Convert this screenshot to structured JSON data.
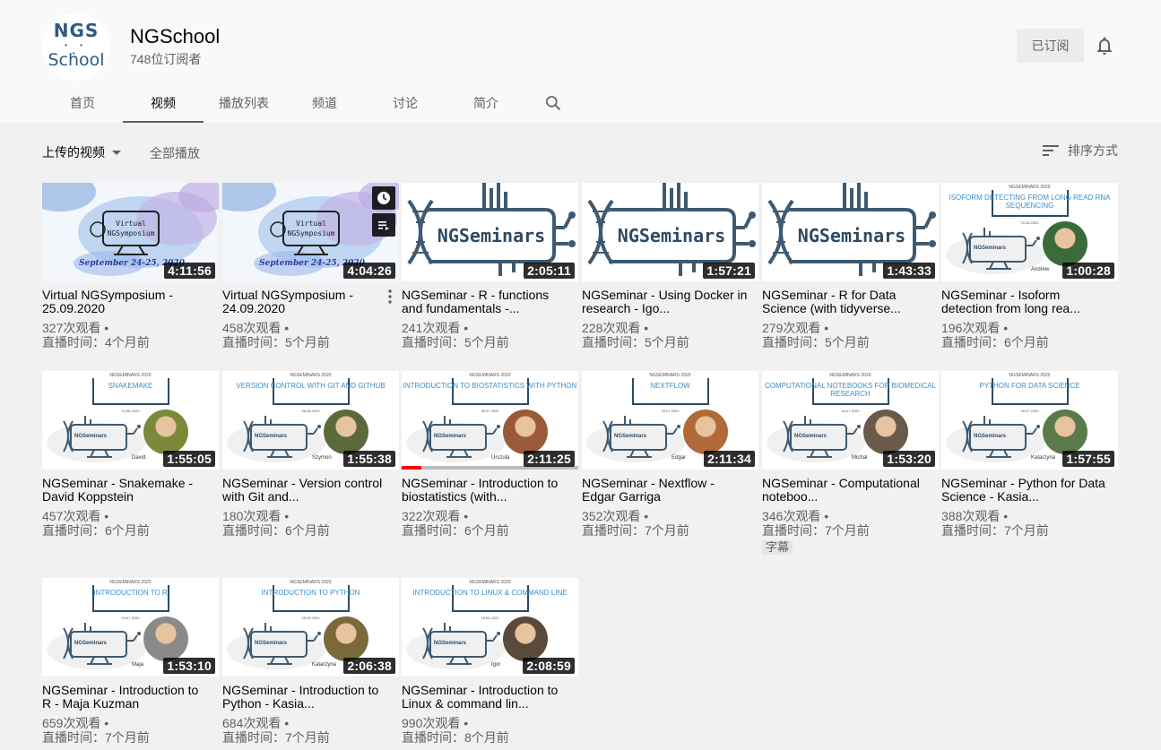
{
  "channel": {
    "avatar_text_top": "NGS",
    "avatar_text_bottom": "School",
    "name": "NGSchool",
    "subscribers": "748位订阅者",
    "subscribed_label": "已订阅"
  },
  "tabs": [
    {
      "label": "首页"
    },
    {
      "label": "视频"
    },
    {
      "label": "播放列表"
    },
    {
      "label": "频道"
    },
    {
      "label": "讨论"
    },
    {
      "label": "简介"
    }
  ],
  "toolbar": {
    "uploads_label": "上传的视频",
    "play_all_label": "全部播放",
    "sort_label": "排序方式"
  },
  "colors": {
    "accent_red": "#ff0000",
    "brand_blue": "#2e5a84",
    "text_secondary": "#606060"
  },
  "videos": [
    {
      "title": "Virtual NGSymposium - 25.09.2020",
      "duration": "4:11:56",
      "views": "327次观看 •",
      "time": "直播时间：4个月前",
      "thumb": "symposium"
    },
    {
      "title": "Virtual NGSymposium - 24.09.2020",
      "duration": "4:04:26",
      "views": "458次观看 •",
      "time": "直播时间：5个月前",
      "thumb": "symposium",
      "hover": true
    },
    {
      "title": "NGSeminar - R - functions and fundamentals -...",
      "duration": "2:05:11",
      "views": "241次观看 •",
      "time": "直播时间：5个月前",
      "thumb": "seminars",
      "logo_text": "NGSeminars"
    },
    {
      "title": "NGSeminar - Using Docker in research - Igo...",
      "duration": "1:57:21",
      "views": "228次观看 •",
      "time": "直播时间：5个月前",
      "thumb": "seminars",
      "logo_text": "NGSeminars"
    },
    {
      "title": "NGSeminar - R for Data Science (with tidyverse...",
      "duration": "1:43:33",
      "views": "279次观看 •",
      "time": "直播时间：5个月前",
      "thumb": "seminars",
      "logo_text": "NGSeminars"
    },
    {
      "title": "NGSeminar - Isoform detection from long rea...",
      "duration": "1:00:28",
      "views": "196次观看 •",
      "time": "直播时间：6个月前",
      "thumb": "slide",
      "slide_header": "NGSEMINARS 2020",
      "slide_title": "ISOFORM DETECTING FROM LONG READ RNA SEQUENCING",
      "slide_date": "20.08.2020",
      "person": "Andrew",
      "face_color": "#3a6b3a"
    },
    {
      "title": "NGSeminar - Snakemake - David Koppstein",
      "duration": "1:55:05",
      "views": "457次观看 •",
      "time": "直播时间：6个月前",
      "thumb": "slide",
      "slide_header": "NGSEMINARS 2020",
      "slide_title": "SNAKEMAKE",
      "slide_date": "13.08.2020",
      "person": "David",
      "face_color": "#7a8a3a"
    },
    {
      "title": "NGSeminar - Version control with Git and...",
      "duration": "1:55:38",
      "views": "180次观看 •",
      "time": "直播时间：6个月前",
      "thumb": "slide",
      "slide_header": "NGSEMINARS 2020",
      "slide_title": "VERSION CONTROL WITH GIT AND GITHUB",
      "slide_date": "06.08.2020",
      "person": "Szymon",
      "face_color": "#5a6a3a"
    },
    {
      "title": "NGSeminar - Introduction to biostatistics (with...",
      "duration": "2:11:25",
      "views": "322次观看 •",
      "time": "直播时间：6个月前",
      "thumb": "slide",
      "slide_header": "NGSEMINARS 2020",
      "slide_title": "INTRODUCTION TO BIOSTATISTICS WITH PYTHON",
      "slide_date": "30.07.2020",
      "person": "Urszula",
      "face_color": "#9a5a3a",
      "progress": 0.11
    },
    {
      "title": "NGSeminar - Nextflow - Edgar Garriga",
      "duration": "2:11:34",
      "views": "352次观看 •",
      "time": "直播时间：7个月前",
      "thumb": "slide",
      "slide_header": "NGSEMINARS 2020",
      "slide_title": "NEXTFLOW",
      "slide_date": "23.07.2020",
      "person": "Edgar",
      "face_color": "#b06a3a"
    },
    {
      "title": "NGSeminar - Computational noteboo...",
      "duration": "1:53:20",
      "views": "346次观看 •",
      "time": "直播时间：7个月前",
      "thumb": "slide",
      "slide_header": "NGSEMINARS 2020",
      "slide_title": "COMPUTATIONAL NOTEBOOKS FOR BIOMEDICAL RESEARCH",
      "slide_date": "16.07.2020",
      "person": "Michal",
      "face_color": "#6a5a4a",
      "badge": "字幕"
    },
    {
      "title": "NGSeminar - Python for Data Science - Kasia...",
      "duration": "1:57:55",
      "views": "388次观看 •",
      "time": "直播时间：7个月前",
      "thumb": "slide",
      "slide_header": "NGSEMINARS 2020",
      "slide_title": "PYTHON FOR DATA SCIENCE",
      "slide_date": "09.07.2020",
      "person": "Katarzyna",
      "face_color": "#5a7a4a"
    },
    {
      "title": "NGSeminar - Introduction to R - Maja Kuzman",
      "duration": "1:53:10",
      "views": "659次观看 •",
      "time": "直播时间：7个月前",
      "thumb": "slide",
      "slide_header": "NGSEMINARS 2020",
      "slide_title": "INTRODUCTION TO R",
      "slide_date": "02.07.2020",
      "person": "Maja",
      "face_color": "#8a8a8a"
    },
    {
      "title": "NGSeminar - Introduction to Python - Kasia...",
      "duration": "2:06:38",
      "views": "684次观看 •",
      "time": "直播时间：7个月前",
      "thumb": "slide",
      "slide_header": "NGSEMINARS 2020",
      "slide_title": "INTRODUCTION TO PYTHON",
      "slide_date": "25.06.2020",
      "person": "Katarzyna",
      "face_color": "#7a6a3a"
    },
    {
      "title": "NGSeminar - Introduction to Linux & command lin...",
      "duration": "2:08:59",
      "views": "990次观看 •",
      "time": "直播时间：8个月前",
      "thumb": "slide",
      "slide_header": "NGSEMINARS 2020",
      "slide_title": "INTRODUCTION TO LINUX & COMMAND LINE",
      "slide_date": "18.06.2020",
      "person": "Igor",
      "face_color": "#5a4a3a"
    }
  ],
  "symposium_text": {
    "line1": "Virtual",
    "line2": "NGSymposium",
    "date": "September 24-25, 2020"
  },
  "mini_logo_text": "NGSeminars",
  "icons": {
    "search": "search-icon",
    "bell": "bell-icon",
    "sort": "sort-icon",
    "clock": "clock-icon",
    "queue": "add-to-queue-icon",
    "more": "more-vert-icon"
  }
}
